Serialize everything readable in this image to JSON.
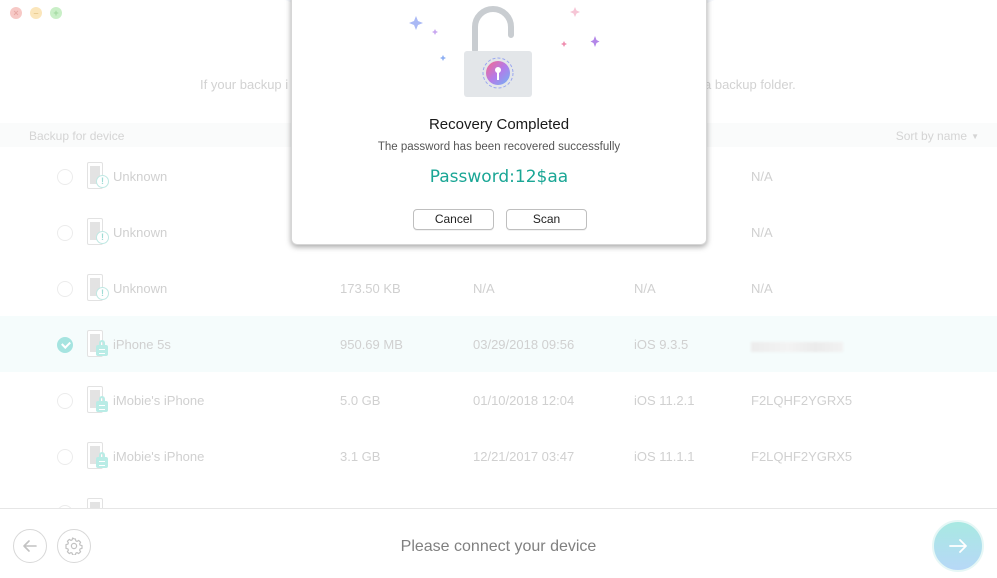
{
  "window": {
    "controls": [
      "close",
      "minimize",
      "maximize"
    ]
  },
  "hint": {
    "left_text": "If your backup i",
    "right_text": "a backup folder."
  },
  "list": {
    "header_title": "Backup for device",
    "sort_label": "Sort by name",
    "rows": [
      {
        "name": "Unknown",
        "size": "",
        "date": "",
        "ios": "",
        "serial": "N/A",
        "status": "warning",
        "selected": false
      },
      {
        "name": "Unknown",
        "size": "",
        "date": "",
        "ios": "",
        "serial": "N/A",
        "status": "warning",
        "selected": false
      },
      {
        "name": "Unknown",
        "size": "173.50 KB",
        "date": "N/A",
        "ios": "N/A",
        "serial": "N/A",
        "status": "warning",
        "selected": false
      },
      {
        "name": "iPhone 5s",
        "size": "950.69 MB",
        "date": "03/29/2018 09:56",
        "ios": "iOS 9.3.5",
        "serial": "",
        "status": "locked",
        "selected": true,
        "serial_blurred": true
      },
      {
        "name": "iMobie's iPhone",
        "size": "5.0 GB",
        "date": "01/10/2018 12:04",
        "ios": "iOS 11.2.1",
        "serial": "F2LQHF2YGRX5",
        "status": "locked",
        "selected": false
      },
      {
        "name": "iMobie's iPhone",
        "size": "3.1 GB",
        "date": "12/21/2017 03:47",
        "ios": "iOS 11.1.1",
        "serial": "F2LQHF2YGRX5",
        "status": "locked",
        "selected": false
      }
    ]
  },
  "dialog": {
    "icon": "unlocked-padlock-icon",
    "title": "Recovery Completed",
    "subtitle": "The password has been recovered successfully",
    "password_text": "Password:12$aa",
    "cancel_label": "Cancel",
    "scan_label": "Scan",
    "accent_color": "#1aa695"
  },
  "footer": {
    "back_icon": "arrow-left-icon",
    "settings_icon": "gear-icon",
    "status_text": "Please connect your device",
    "next_icon": "arrow-right-icon"
  }
}
